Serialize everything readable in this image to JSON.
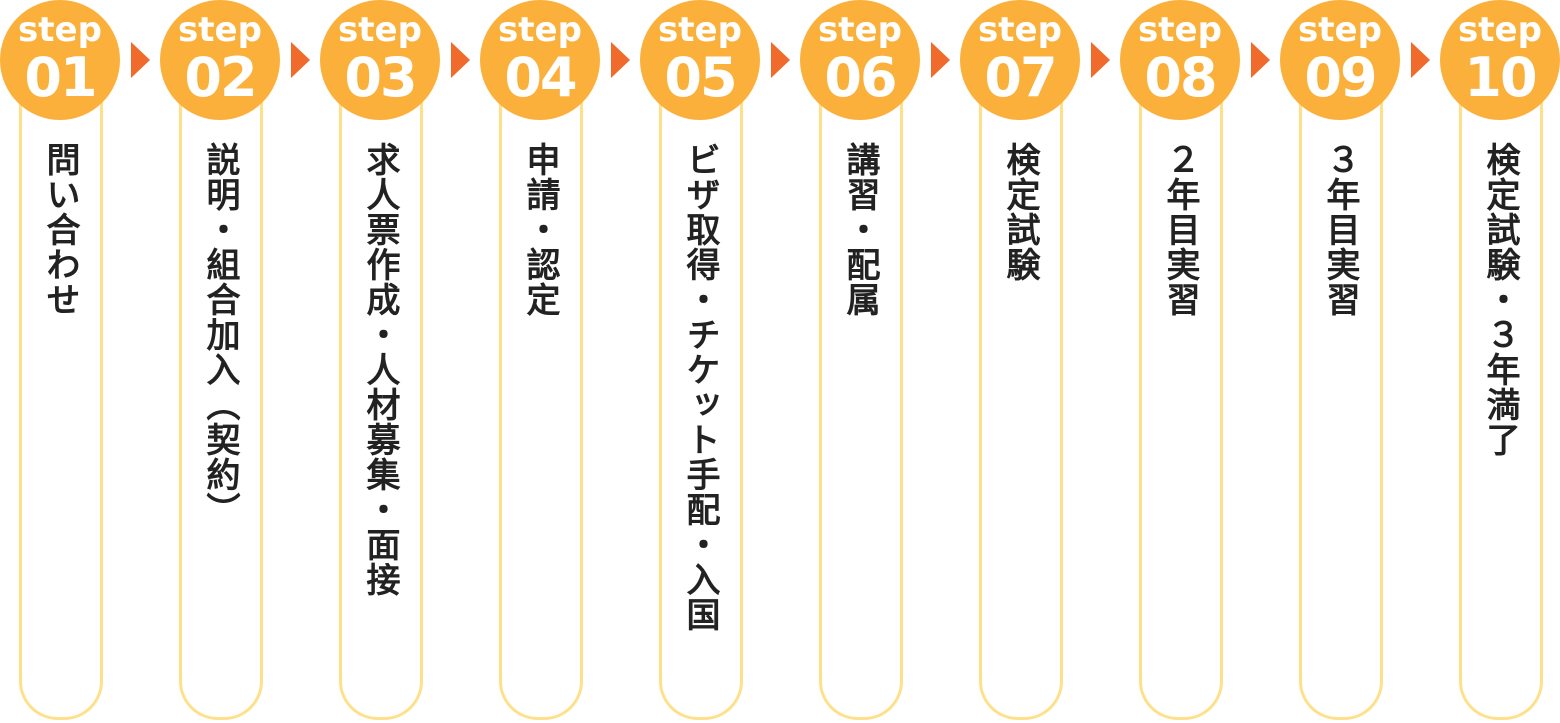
{
  "badge_word": "step",
  "colors": {
    "badge": "#fbb03b",
    "arrow": "#f06a2c",
    "outline": "#ffe08a",
    "text": "#222222"
  },
  "steps": [
    {
      "number": "01",
      "label": "問い合わせ"
    },
    {
      "number": "02",
      "label": "説明・組合加入（契約）"
    },
    {
      "number": "03",
      "label": "求人票作成・人材募集・面接"
    },
    {
      "number": "04",
      "label": "申請・認定"
    },
    {
      "number": "05",
      "label": "ビザ取得・チケット手配・入国"
    },
    {
      "number": "06",
      "label": "講習・配属"
    },
    {
      "number": "07",
      "label": "検定試験"
    },
    {
      "number": "08",
      "label": "２年目実習"
    },
    {
      "number": "09",
      "label": "３年目実習"
    },
    {
      "number": "10",
      "label": "検定試験・３年満了"
    }
  ]
}
